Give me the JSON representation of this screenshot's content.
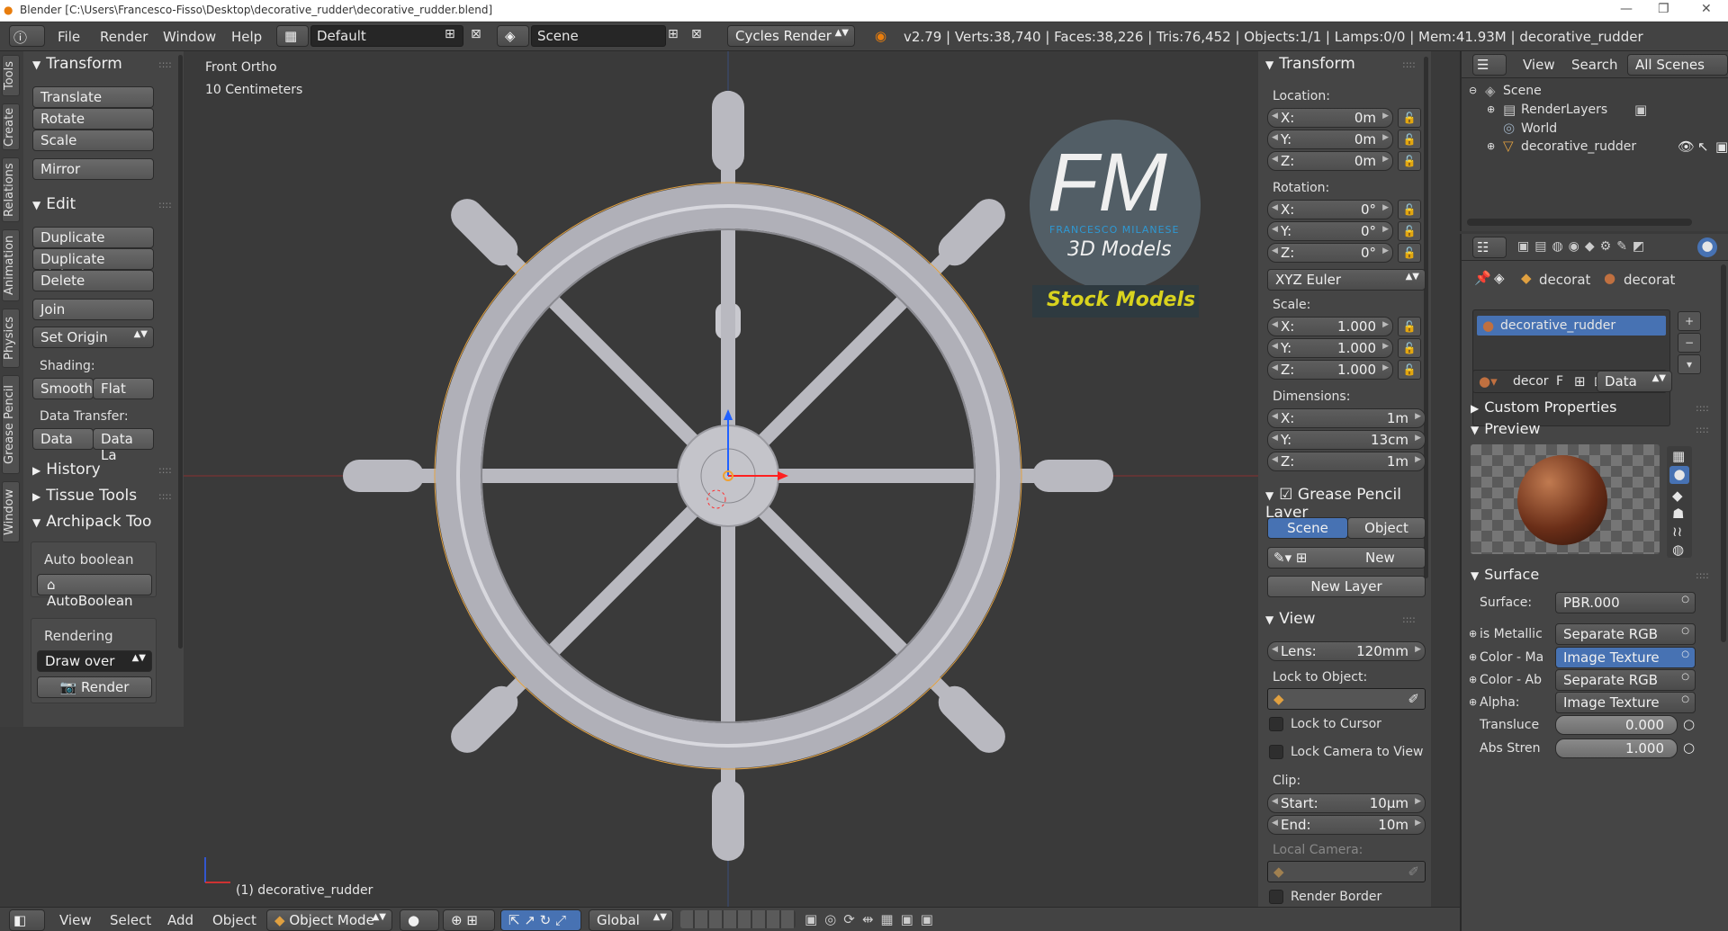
{
  "window": {
    "title": "Blender [C:\\Users\\Francesco-Fisso\\Desktop\\decorative_rudder\\decorative_rudder.blend]",
    "controls": [
      "—",
      "❐",
      "✕"
    ]
  },
  "topbar": {
    "menus": [
      "File",
      "Render",
      "Window",
      "Help"
    ],
    "layout": "Default",
    "scene": "Scene",
    "engine": "Cycles Render",
    "stats": "v2.79 | Verts:38,740 | Faces:38,226 | Tris:76,452 | Objects:1/1 | Lamps:0/0 | Mem:41.93M | decorative_rudder"
  },
  "tool_tabs": [
    "Tools",
    "Create",
    "Relations",
    "Animation",
    "Physics",
    "Grease Pencil",
    "Window"
  ],
  "toolshelf": {
    "transform_header": "Transform",
    "translate": "Translate",
    "rotate": "Rotate",
    "scale": "Scale",
    "mirror": "Mirror",
    "edit_header": "Edit",
    "duplicate": "Duplicate",
    "duplicate_linked": "Duplicate Linked",
    "delete": "Delete",
    "join": "Join",
    "set_origin": "Set Origin",
    "shading_label": "Shading:",
    "smooth": "Smooth",
    "flat": "Flat",
    "data_transfer_label": "Data Transfer:",
    "data": "Data",
    "data_la": "Data La",
    "history": "History",
    "tissue": "Tissue Tools",
    "archipack": "Archipack Too",
    "auto_boolean_label": "Auto boolean",
    "autoboolean_btn": "AutoBoolean",
    "rendering_label": "Rendering",
    "draw_over": "Draw over",
    "render_btn": "Render"
  },
  "viewport": {
    "view_name": "Front Ortho",
    "scale": "10 Centimeters",
    "object_label": "(1) decorative_rudder",
    "logo_text": "FM",
    "logo_sub": "FRANCESCO MILANESE",
    "logo_models": "3D Models",
    "stock": "Stock Models"
  },
  "properties": {
    "transform_header": "Transform",
    "location_label": "Location:",
    "loc": [
      {
        "k": "X:",
        "v": "0m"
      },
      {
        "k": "Y:",
        "v": "0m"
      },
      {
        "k": "Z:",
        "v": "0m"
      }
    ],
    "rotation_label": "Rotation:",
    "rot": [
      {
        "k": "X:",
        "v": "0°"
      },
      {
        "k": "Y:",
        "v": "0°"
      },
      {
        "k": "Z:",
        "v": "0°"
      }
    ],
    "rot_mode": "XYZ Euler",
    "scale_label": "Scale:",
    "scl": [
      {
        "k": "X:",
        "v": "1.000"
      },
      {
        "k": "Y:",
        "v": "1.000"
      },
      {
        "k": "Z:",
        "v": "1.000"
      }
    ],
    "dimensions_label": "Dimensions:",
    "dim": [
      {
        "k": "X:",
        "v": "1m"
      },
      {
        "k": "Y:",
        "v": "13cm"
      },
      {
        "k": "Z:",
        "v": "1m"
      }
    ],
    "gp_header": "Grease Pencil Layer",
    "gp_scene": "Scene",
    "gp_object": "Object",
    "gp_new": "New",
    "gp_new_layer": "New Layer",
    "view_header": "View",
    "lens_k": "Lens:",
    "lens_v": "120mm",
    "lock_obj": "Lock to Object:",
    "lock_cursor": "Lock to Cursor",
    "lock_camera": "Lock Camera to View",
    "clip_label": "Clip:",
    "clip_start_k": "Start:",
    "clip_start_v": "10µm",
    "clip_end_k": "End:",
    "clip_end_v": "10m",
    "local_camera": "Local Camera:",
    "render_border": "Render Border"
  },
  "outliner": {
    "view": "View",
    "search": "Search",
    "all_scenes": "All Scenes",
    "scene": "Scene",
    "render_layers": "RenderLayers",
    "world": "World",
    "object": "decorative_rudder"
  },
  "material": {
    "crumb1": "decorat",
    "crumb2": "decorat",
    "slot": "decorative_rudder",
    "name_field": "decor",
    "f": "F",
    "data": "Data",
    "custom_props": "Custom Properties",
    "preview": "Preview",
    "surface_header": "Surface",
    "surface_k": "Surface:",
    "surface_v": "PBR.000",
    "rows": [
      {
        "k": "is Metallic",
        "v": "Separate RGB",
        "hl": false
      },
      {
        "k": "Color - Ma",
        "v": "Image Texture",
        "hl": true
      },
      {
        "k": "Color - Ab",
        "v": "Separate RGB",
        "hl": false
      },
      {
        "k": "Alpha:",
        "v": "Image Texture",
        "hl": false
      }
    ],
    "translucency_k": "Transluce",
    "translucency_v": "0.000",
    "abs_k": "Abs Stren",
    "abs_v": "1.000"
  },
  "bottombar": {
    "view": "View",
    "select": "Select",
    "add": "Add",
    "object": "Object",
    "mode": "Object Mode",
    "orientation": "Global"
  },
  "colors": {
    "selection": "#4772b3",
    "accent_orange": "#f0a030",
    "viewport_bg": "#3a3a3a"
  }
}
